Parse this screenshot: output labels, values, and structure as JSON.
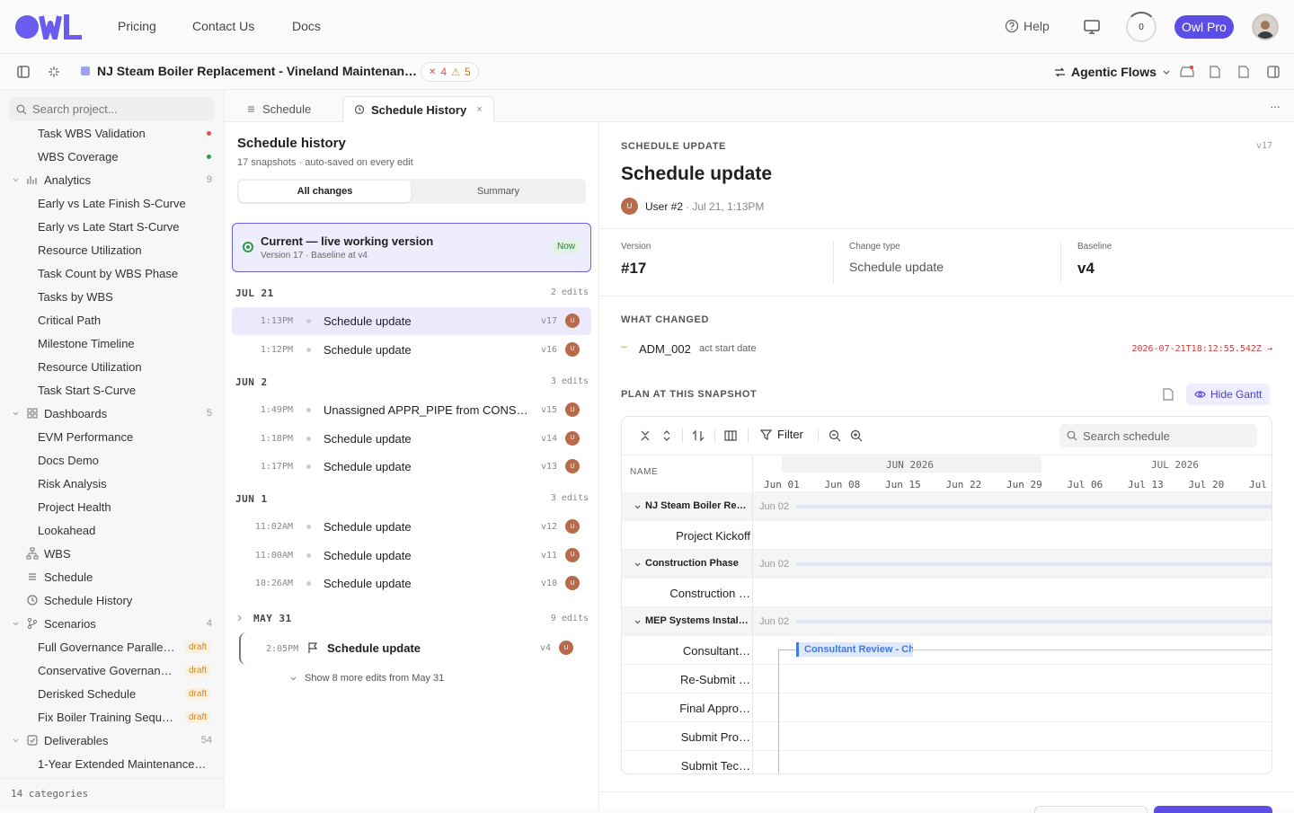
{
  "nav": {
    "links": [
      "Pricing",
      "Contact Us",
      "Docs"
    ],
    "help": "Help",
    "ring_value": "0",
    "pro_label": "Owl Pro"
  },
  "toolbar": {
    "project": "NJ Steam Boiler Replacement - Vineland Maintenan…",
    "errors": "4",
    "warnings": "5",
    "agentic": "Agentic Flows"
  },
  "sidebar": {
    "search_placeholder": "Search project...",
    "items": [
      {
        "label": "Task WBS Validation",
        "level": 2,
        "dot": "#d9534f"
      },
      {
        "label": "WBS Coverage",
        "level": 2,
        "dot": "#3a9a55"
      },
      {
        "label": "Analytics",
        "level": 1,
        "count": "9",
        "icon": "chart-icon"
      },
      {
        "label": "Early vs Late Finish S-Curve",
        "level": 2
      },
      {
        "label": "Early vs Late Start S-Curve",
        "level": 2
      },
      {
        "label": "Resource Utilization",
        "level": 2
      },
      {
        "label": "Task Count by WBS Phase",
        "level": 2
      },
      {
        "label": "Tasks by WBS",
        "level": 2
      },
      {
        "label": "Critical Path",
        "level": 2
      },
      {
        "label": "Milestone Timeline",
        "level": 2
      },
      {
        "label": "Resource Utilization",
        "level": 2
      },
      {
        "label": "Task Start S-Curve",
        "level": 2
      },
      {
        "label": "Dashboards",
        "level": 1,
        "count": "5",
        "icon": "grid-icon"
      },
      {
        "label": "EVM Performance",
        "level": 2
      },
      {
        "label": "Docs Demo",
        "level": 2
      },
      {
        "label": "Risk Analysis",
        "level": 2
      },
      {
        "label": "Project Health",
        "level": 2
      },
      {
        "label": "Lookahead",
        "level": 2
      },
      {
        "label": "WBS",
        "level": 3,
        "icon": "hierarchy-icon"
      },
      {
        "label": "Schedule",
        "level": 3,
        "icon": "list-icon"
      },
      {
        "label": "Schedule History",
        "level": 3,
        "icon": "history-icon"
      },
      {
        "label": "Scenarios",
        "level": 1,
        "count": "4",
        "icon": "branch-icon"
      },
      {
        "label": "Full Governance Parallel…",
        "level": 2,
        "draft": "draft"
      },
      {
        "label": "Conservative Governanc…",
        "level": 2,
        "draft": "draft"
      },
      {
        "label": "Derisked Schedule",
        "level": 2,
        "draft": "draft"
      },
      {
        "label": "Fix Boiler Training Sequ…",
        "level": 2,
        "draft": "draft"
      },
      {
        "label": "Deliverables",
        "level": 1,
        "count": "54",
        "icon": "check-icon"
      },
      {
        "label": "1-Year Extended Maintenance …",
        "level": 2
      }
    ],
    "footer": "14 categories"
  },
  "tabs": [
    {
      "label": "Schedule"
    },
    {
      "label": "Schedule History"
    }
  ],
  "history": {
    "title": "Schedule history",
    "subtitle": "17 snapshots · auto-saved on every edit",
    "seg": [
      "All changes",
      "Summary"
    ],
    "current": {
      "title": "Current — live working version",
      "sub": "Version 17 · Baseline at v4",
      "badge": "Now"
    },
    "groups": [
      {
        "date": "JUL 21",
        "count": "2 edits",
        "rows": [
          {
            "time": "1:13PM",
            "text": "Schedule update",
            "ver": "v17",
            "sel": true
          },
          {
            "time": "1:12PM",
            "text": "Schedule update",
            "ver": "v16"
          }
        ]
      },
      {
        "date": "JUN 2",
        "count": "3 edits",
        "rows": [
          {
            "time": "1:49PM",
            "text": "Unassigned APPR_PIPE from CONSTOO…",
            "ver": "v15"
          },
          {
            "time": "1:18PM",
            "text": "Schedule update",
            "ver": "v14"
          },
          {
            "time": "1:17PM",
            "text": "Schedule update",
            "ver": "v13"
          }
        ]
      },
      {
        "date": "JUN 1",
        "count": "3 edits",
        "rows": [
          {
            "time": "11:02AM",
            "text": "Schedule update",
            "ver": "v12"
          },
          {
            "time": "11:00AM",
            "text": "Schedule update",
            "ver": "v11"
          },
          {
            "time": "10:26AM",
            "text": "Schedule update",
            "ver": "v10"
          }
        ]
      }
    ],
    "may": {
      "date": "MAY 31",
      "count": "9 edits",
      "time": "2:05PM",
      "text": "Schedule update",
      "ver": "v4",
      "more": "Show 8 more edits from May 31"
    },
    "avatar": "U"
  },
  "detail": {
    "caption": "SCHEDULE UPDATE",
    "ver": "v17",
    "title": "Schedule update",
    "user": "User #2",
    "when": "· Jul 21, 1:13PM",
    "meta": [
      {
        "k": "Version",
        "v": "#17"
      },
      {
        "k": "Change type",
        "v": "Schedule update"
      },
      {
        "k": "Baseline",
        "v": "v4"
      }
    ],
    "what_changed": "WHAT CHANGED",
    "change": {
      "id": "ADM_002",
      "field": "act start date",
      "value": "2026-07-21T18:12:55.542Z →"
    },
    "plan": "PLAN AT THIS SNAPSHOT",
    "hide_gantt": "Hide Gantt"
  },
  "gantt": {
    "filter": "Filter",
    "search": "Search schedule",
    "name_header": "NAME",
    "months": [
      "JUN 2026",
      "JUL 2026"
    ],
    "weeks": [
      "Jun 01",
      "Jun 08",
      "Jun 15",
      "Jun 22",
      "Jun 29",
      "Jul 06",
      "Jul 13",
      "Jul 20",
      "Jul"
    ],
    "rows": [
      {
        "name": "NJ Steam Boiler Repl…",
        "grp": true,
        "date": "Jun 02"
      },
      {
        "name": "Project Kickoff"
      },
      {
        "name": "Construction Phase",
        "grp": true,
        "date": "Jun 02"
      },
      {
        "name": "Construction …"
      },
      {
        "name": "MEP Systems Installa…",
        "grp": true,
        "date": "Jun 02"
      },
      {
        "name": "Consultant…"
      },
      {
        "name": "Re-Submit …"
      },
      {
        "name": "Final Appro…"
      },
      {
        "name": "Submit Pro…"
      },
      {
        "name": "Submit Tec…"
      }
    ],
    "bar_label": "Consultant Review - Chi"
  }
}
